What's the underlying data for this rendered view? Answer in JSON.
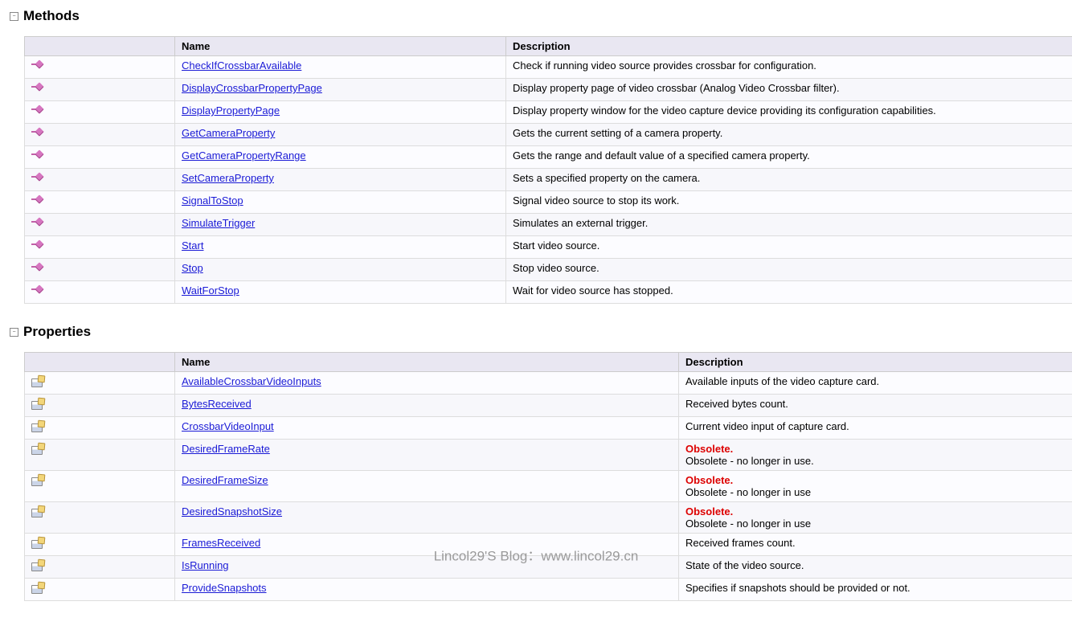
{
  "methods_section": {
    "title": "Methods"
  },
  "properties_section": {
    "title": "Properties"
  },
  "headers": {
    "name": "Name",
    "description": "Description"
  },
  "obsolete_label": "Obsolete.",
  "methods": [
    {
      "name": "CheckIfCrossbarAvailable",
      "desc": "Check if running video source provides crossbar for configuration."
    },
    {
      "name": "DisplayCrossbarPropertyPage",
      "desc": "Display property page of video crossbar (Analog Video Crossbar filter)."
    },
    {
      "name": "DisplayPropertyPage",
      "desc": "Display property window for the video capture device providing its configuration capabilities."
    },
    {
      "name": "GetCameraProperty",
      "desc": "Gets the current setting of a camera property."
    },
    {
      "name": "GetCameraPropertyRange",
      "desc": "Gets the range and default value of a specified camera property."
    },
    {
      "name": "SetCameraProperty",
      "desc": "Sets a specified property on the camera."
    },
    {
      "name": "SignalToStop",
      "desc": "Signal video source to stop its work."
    },
    {
      "name": "SimulateTrigger",
      "desc": "Simulates an external trigger."
    },
    {
      "name": "Start",
      "desc": "Start video source."
    },
    {
      "name": "Stop",
      "desc": "Stop video source."
    },
    {
      "name": "WaitForStop",
      "desc": "Wait for video source has stopped."
    }
  ],
  "properties": [
    {
      "name": "AvailableCrossbarVideoInputs",
      "desc": "Available inputs of the video capture card.",
      "obsolete": false
    },
    {
      "name": "BytesReceived",
      "desc": "Received bytes count.",
      "obsolete": false
    },
    {
      "name": "CrossbarVideoInput",
      "desc": "Current video input of capture card.",
      "obsolete": false
    },
    {
      "name": "DesiredFrameRate",
      "desc": "Obsolete - no longer in use.",
      "obsolete": true
    },
    {
      "name": "DesiredFrameSize",
      "desc": "Obsolete - no longer in use",
      "obsolete": true
    },
    {
      "name": "DesiredSnapshotSize",
      "desc": "Obsolete - no longer in use",
      "obsolete": true
    },
    {
      "name": "FramesReceived",
      "desc": "Received frames count.",
      "obsolete": false
    },
    {
      "name": "IsRunning",
      "desc": "State of the video source.",
      "obsolete": false
    },
    {
      "name": "ProvideSnapshots",
      "desc": "Specifies if snapshots should be provided or not.",
      "obsolete": false
    }
  ],
  "watermark": "Lincol29'S Blog：www.lincol29.cn"
}
